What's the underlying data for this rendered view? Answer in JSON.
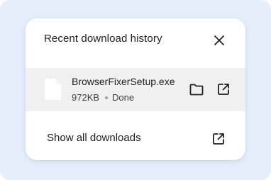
{
  "dialog": {
    "title": "Recent download history",
    "close_icon": "close-icon"
  },
  "download": {
    "file_icon": "file-icon",
    "file_name": "BrowserFixerSetup.exe",
    "size": "972KB",
    "status": "Done",
    "folder_icon": "folder-icon",
    "open_icon": "open-external-icon"
  },
  "footer": {
    "show_all_label": "Show all downloads",
    "show_all_icon": "open-external-icon"
  },
  "colors": {
    "backdrop": "#e6eefc",
    "panel": "#ffffff",
    "row_highlight": "#f0f0f0",
    "text": "#202124"
  }
}
